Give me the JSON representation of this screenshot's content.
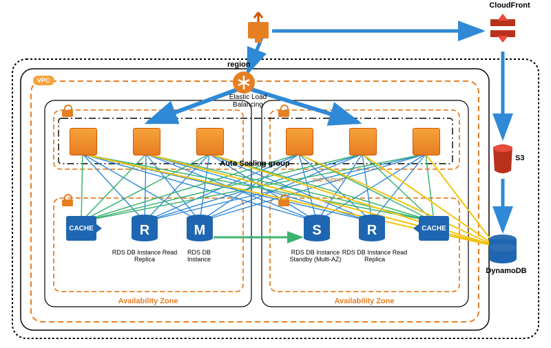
{
  "labels": {
    "cloudfront": "CloudFront",
    "s3": "S3",
    "dynamodb": "DynamoDB",
    "region": "region",
    "vpc": "VPC",
    "elb": "Elastic Load Balancing",
    "asg": "Auto Scaling group",
    "pubsubnet": "pub subnet",
    "az": "Availability Zone",
    "rds_read": "RDS DB Instance Read Replica",
    "rds_master": "RDS DB Instance",
    "rds_standby": "RDS DB Instance Standby (Multi-AZ)",
    "cache": "CACHE",
    "db_r": "R",
    "db_m": "M",
    "db_s": "S"
  },
  "architecture": {
    "edge": [
      "CloudFront",
      "S3",
      "DynamoDB"
    ],
    "region": {
      "services": [
        "Elastic Load Balancing"
      ],
      "vpc": {
        "auto_scaling_group": true,
        "availability_zones": [
          {
            "public_subnet": {
              "ec2_instances": 3
            },
            "private_subnet": {
              "cache": 1,
              "rds": [
                {
                  "role": "Read Replica",
                  "letter": "R"
                },
                {
                  "role": "Master",
                  "letter": "M"
                }
              ]
            }
          },
          {
            "public_subnet": {
              "ec2_instances": 3
            },
            "private_subnet": {
              "cache": 1,
              "rds": [
                {
                  "role": "Standby (Multi-AZ)",
                  "letter": "S"
                },
                {
                  "role": "Read Replica",
                  "letter": "R"
                }
              ]
            }
          }
        ]
      }
    },
    "connections": [
      {
        "from": "client",
        "to": "CloudFront",
        "color": "blue"
      },
      {
        "from": "client",
        "to": "Elastic Load Balancing",
        "color": "blue"
      },
      {
        "from": "CloudFront",
        "to": "S3",
        "color": "blue"
      },
      {
        "from": "S3",
        "to": "DynamoDB",
        "color": "blue"
      },
      {
        "from": "Elastic Load Balancing",
        "to": "EC2 (AZ1)",
        "color": "blue"
      },
      {
        "from": "Elastic Load Balancing",
        "to": "EC2 (AZ2)",
        "color": "blue"
      },
      {
        "from": "EC2",
        "to": "RDS",
        "color": "blue",
        "pattern": "mesh"
      },
      {
        "from": "EC2",
        "to": "Cache",
        "color": "green",
        "pattern": "mesh"
      },
      {
        "from": "EC2",
        "to": "DynamoDB",
        "color": "yellow",
        "pattern": "mesh"
      },
      {
        "from": "RDS Master",
        "to": "RDS Standby",
        "color": "green"
      }
    ]
  }
}
